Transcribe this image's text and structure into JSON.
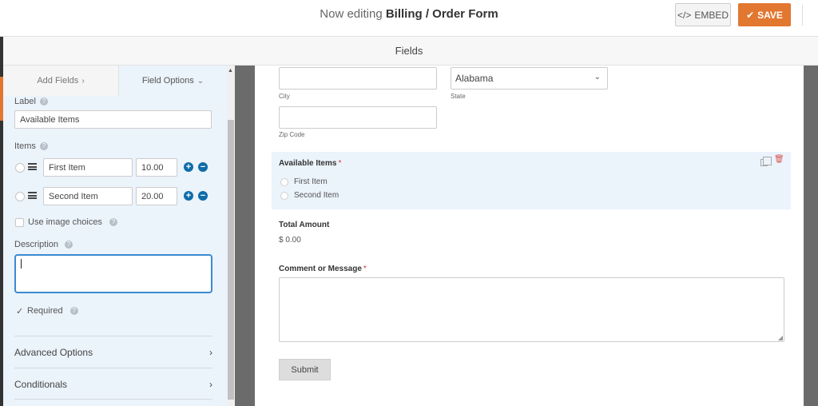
{
  "header": {
    "title_prefix": "Now editing",
    "title_name": "Billing / Order Form",
    "embed_label": "EMBED",
    "save_label": "SAVE"
  },
  "section": {
    "title": "Fields"
  },
  "panel": {
    "tabs": {
      "add_fields": "Add Fields",
      "field_options": "Field Options"
    },
    "label_title": "Label",
    "label_value": "Available Items",
    "items_title": "Items",
    "items": [
      {
        "label": "First Item",
        "price": "10.00"
      },
      {
        "label": "Second Item",
        "price": "20.00"
      }
    ],
    "use_image_choices": "Use image choices",
    "description_title": "Description",
    "description_value": "",
    "required_label": "Required",
    "required_checked": true,
    "advanced_options": "Advanced Options",
    "conditionals": "Conditionals"
  },
  "preview": {
    "city_label": "City",
    "state_label": "State",
    "state_value": "Alabama",
    "zip_label": "Zip Code",
    "available_items_title": "Available Items",
    "choices": [
      "First Item",
      "Second Item"
    ],
    "total_title": "Total Amount",
    "total_value": "$ 0.00",
    "comment_title": "Comment or Message",
    "submit_label": "Submit"
  },
  "colors": {
    "accent": "#e27730",
    "panel_bg": "#ebf3fb",
    "action_blue": "#0e6ca9",
    "required_red": "#d63638"
  }
}
